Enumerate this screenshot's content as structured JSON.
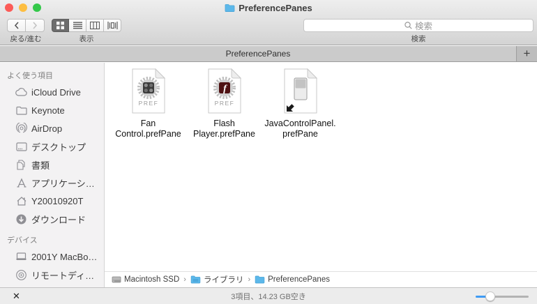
{
  "window": {
    "title": "PreferencePanes"
  },
  "toolbar": {
    "back_forward_label": "戻る/進む",
    "view_label": "表示",
    "search_label": "検索",
    "search_placeholder": "検索"
  },
  "tabbar": {
    "tab_label": "PreferencePanes",
    "new_tab_label": "+"
  },
  "sidebar": {
    "sections": [
      {
        "header": "よく使う項目",
        "items": [
          {
            "label": "iCloud Drive",
            "icon": "icloud-icon"
          },
          {
            "label": "Keynote",
            "icon": "folder-icon"
          },
          {
            "label": "AirDrop",
            "icon": "airdrop-icon"
          },
          {
            "label": "デスクトップ",
            "icon": "desktop-icon"
          },
          {
            "label": "書類",
            "icon": "documents-icon"
          },
          {
            "label": "アプリケーシ…",
            "icon": "applications-icon"
          },
          {
            "label": "Y20010920T",
            "icon": "home-icon"
          },
          {
            "label": "ダウンロード",
            "icon": "downloads-icon"
          }
        ]
      },
      {
        "header": "デバイス",
        "items": [
          {
            "label": "2001Y MacBo…",
            "icon": "laptop-icon"
          },
          {
            "label": "リモートディ…",
            "icon": "remote-disc-icon"
          }
        ]
      }
    ]
  },
  "content": {
    "files": [
      {
        "line1": "Fan",
        "line2": "Control.prefPane",
        "badge": "PREF",
        "kind": "prefpane-fan"
      },
      {
        "line1": "Flash",
        "line2": "Player.prefPane",
        "badge": "PREF",
        "kind": "prefpane-flash"
      },
      {
        "line1": "JavaControlPanel.",
        "line2": "prefPane",
        "kind": "alias-switch"
      }
    ]
  },
  "pathbar": {
    "separator": "›",
    "items": [
      {
        "label": "Macintosh SSD",
        "icon": "drive-icon"
      },
      {
        "label": "ライブラリ",
        "icon": "blue-folder-icon"
      },
      {
        "label": "PreferencePanes",
        "icon": "blue-folder-icon"
      }
    ]
  },
  "statusbar": {
    "status_text": "3項目、14.23 GB空き"
  },
  "colors": {
    "traffic_red": "#fc5b57",
    "traffic_yellow": "#fdbe41",
    "traffic_green": "#34c84a",
    "folder_blue": "#5cb8ea",
    "accent_blue": "#3f9bf4",
    "selected_segment": "#6d6d6d",
    "flash_maroon": "#4e1112"
  }
}
